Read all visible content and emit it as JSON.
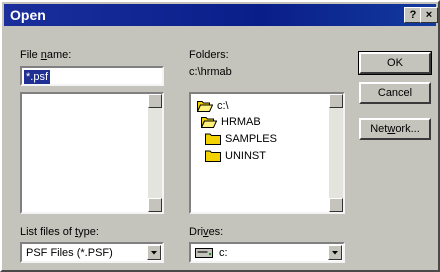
{
  "window": {
    "title": "Open",
    "help_button": "?",
    "close_button": "×"
  },
  "file_name": {
    "label_prefix": "File ",
    "label_accel": "n",
    "label_suffix": "ame:",
    "value": "*.psf"
  },
  "folders": {
    "label": "Folders:",
    "current_path": "c:\\hrmab",
    "items": [
      {
        "name": "c:\\",
        "icon": "open-folder-icon"
      },
      {
        "name": "HRMAB",
        "icon": "open-folder-icon"
      },
      {
        "name": "SAMPLES",
        "icon": "closed-folder-icon"
      },
      {
        "name": "UNINST",
        "icon": "closed-folder-icon"
      }
    ]
  },
  "file_type": {
    "label_prefix": "List files of ",
    "label_accel": "t",
    "label_suffix": "ype:",
    "selected": "PSF Files (*.PSF)"
  },
  "drives": {
    "label_prefix": "Dri",
    "label_accel": "v",
    "label_suffix": "es:",
    "selected": "c:",
    "icon": "drive-icon"
  },
  "buttons": {
    "ok": "OK",
    "cancel": "Cancel",
    "network_prefix": "Net",
    "network_accel": "w",
    "network_suffix": "ork..."
  },
  "colors": {
    "title_bar": "#0a1e8a",
    "selection": "#1f2f94",
    "folder_yellow": "#f2d200",
    "dialog_face": "#c4c4bc"
  }
}
